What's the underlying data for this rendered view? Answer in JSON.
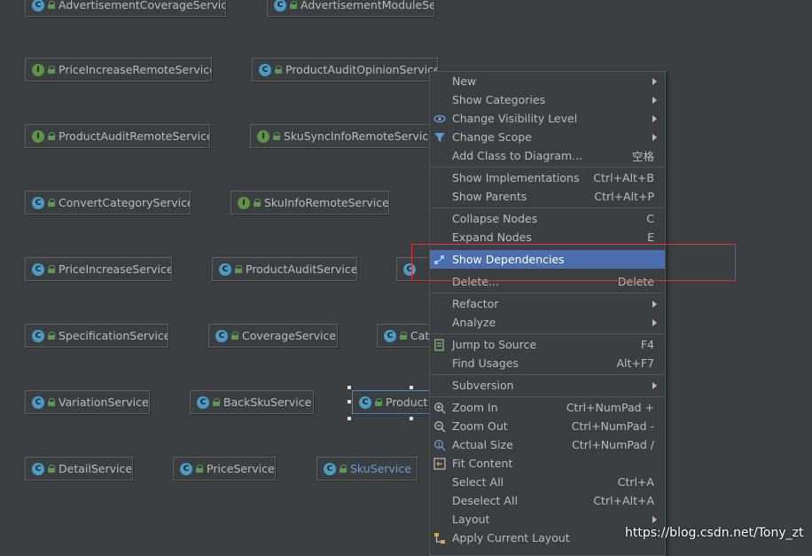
{
  "nodes": [
    {
      "kind": "C",
      "label": "AdvertisementCoverageService"
    },
    {
      "kind": "C",
      "label": "AdvertisementModuleService"
    },
    {
      "kind": "I",
      "label": "PriceIncreaseRemoteService"
    },
    {
      "kind": "C",
      "label": "ProductAuditOpinionService"
    },
    {
      "kind": "I",
      "label": "ProductAuditRemoteService"
    },
    {
      "kind": "I",
      "label": "SkuSyncInfoRemoteService"
    },
    {
      "kind": "C",
      "label": "ConvertCategoryService"
    },
    {
      "kind": "I",
      "label": "SkuInfoRemoteService"
    },
    {
      "kind": "C",
      "label": "PriceIncreaseService"
    },
    {
      "kind": "C",
      "label": "ProductAuditService"
    },
    {
      "kind": "C",
      "label": ""
    },
    {
      "kind": "C",
      "label": "SpecificationService"
    },
    {
      "kind": "C",
      "label": "CoverageService"
    },
    {
      "kind": "C",
      "label": "Cat"
    },
    {
      "kind": "C",
      "label": "VariationService"
    },
    {
      "kind": "C",
      "label": "BackSkuService"
    },
    {
      "kind": "C",
      "label": "Product"
    },
    {
      "kind": "C",
      "label": "DetailService"
    },
    {
      "kind": "C",
      "label": "PriceService"
    },
    {
      "kind": "C",
      "label": "SkuService"
    }
  ],
  "menu": {
    "items": [
      {
        "label": "New",
        "shortcut": "",
        "submenu": true,
        "icon": ""
      },
      {
        "label": "Show Categories",
        "shortcut": "",
        "submenu": true,
        "icon": ""
      },
      {
        "label": "Change Visibility Level",
        "shortcut": "",
        "submenu": true,
        "icon": "eye-icon"
      },
      {
        "label": "Change Scope",
        "shortcut": "",
        "submenu": true,
        "icon": "filter-icon"
      },
      {
        "label": "Add Class to Diagram...",
        "shortcut": "空格",
        "submenu": false,
        "icon": ""
      },
      {
        "label": "Show Implementations",
        "shortcut": "Ctrl+Alt+B",
        "submenu": false,
        "icon": ""
      },
      {
        "label": "Show Parents",
        "shortcut": "Ctrl+Alt+P",
        "submenu": false,
        "icon": ""
      },
      {
        "label": "Collapse Nodes",
        "shortcut": "C",
        "submenu": false,
        "icon": ""
      },
      {
        "label": "Expand Nodes",
        "shortcut": "E",
        "submenu": false,
        "icon": ""
      },
      {
        "label": "Show Dependencies",
        "shortcut": "",
        "submenu": false,
        "icon": "dependencies-icon",
        "highlighted": true
      },
      {
        "label": "Delete...",
        "shortcut": "Delete",
        "submenu": false,
        "icon": ""
      },
      {
        "label": "Refactor",
        "shortcut": "",
        "submenu": true,
        "icon": ""
      },
      {
        "label": "Analyze",
        "shortcut": "",
        "submenu": true,
        "icon": ""
      },
      {
        "label": "Jump to Source",
        "shortcut": "F4",
        "submenu": false,
        "icon": "jump-to-source-icon"
      },
      {
        "label": "Find Usages",
        "shortcut": "Alt+F7",
        "submenu": false,
        "icon": ""
      },
      {
        "label": "Subversion",
        "shortcut": "",
        "submenu": true,
        "icon": ""
      },
      {
        "label": "Zoom In",
        "shortcut": "Ctrl+NumPad +",
        "submenu": false,
        "icon": "zoom-in-icon"
      },
      {
        "label": "Zoom Out",
        "shortcut": "Ctrl+NumPad -",
        "submenu": false,
        "icon": "zoom-out-icon"
      },
      {
        "label": "Actual Size",
        "shortcut": "Ctrl+NumPad /",
        "submenu": false,
        "icon": "actual-size-icon"
      },
      {
        "label": "Fit Content",
        "shortcut": "",
        "submenu": false,
        "icon": "fit-content-icon"
      },
      {
        "label": "Select All",
        "shortcut": "Ctrl+A",
        "submenu": false,
        "icon": ""
      },
      {
        "label": "Deselect All",
        "shortcut": "Ctrl+Alt+A",
        "submenu": false,
        "icon": ""
      },
      {
        "label": "Layout",
        "shortcut": "",
        "submenu": true,
        "icon": ""
      },
      {
        "label": "Apply Current Layout",
        "shortcut": "",
        "submenu": false,
        "icon": "layout-icon"
      }
    ]
  },
  "watermark": "https://blog.csdn.net/Tony_zt",
  "colors": {
    "canvas_bg": "#3c3f41",
    "highlight": "#4b6eaf",
    "red_box": "#e0303a",
    "class_badge": "#4a9cc4",
    "interface_badge": "#5f9448"
  }
}
